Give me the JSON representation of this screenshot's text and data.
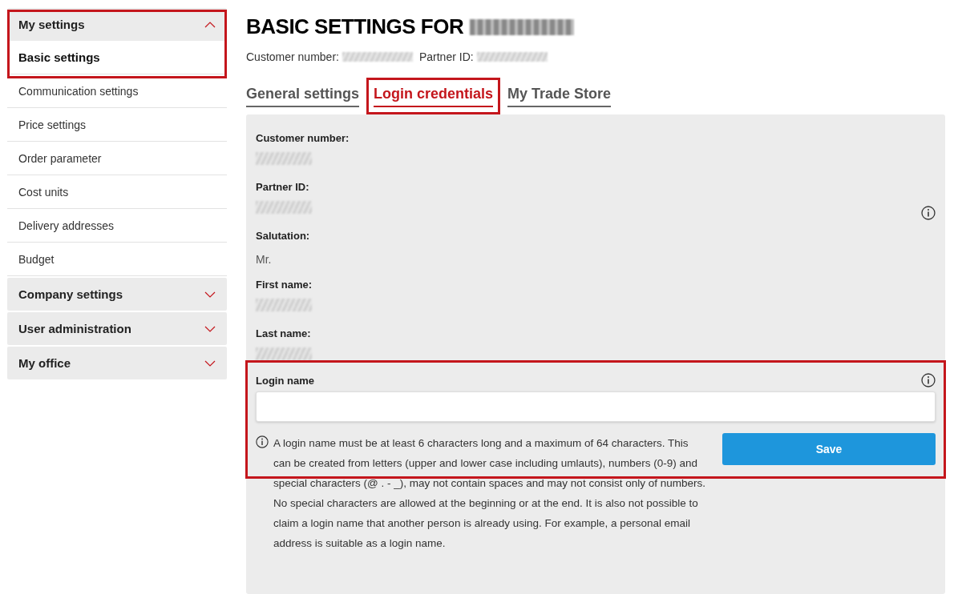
{
  "sidebar": {
    "groups": [
      {
        "title": "My settings",
        "expanded": true,
        "highlighted": true,
        "items": [
          {
            "label": "Basic settings",
            "selected": true
          },
          {
            "label": "Communication settings",
            "selected": false
          },
          {
            "label": "Price settings",
            "selected": false
          },
          {
            "label": "Order parameter",
            "selected": false
          },
          {
            "label": "Cost units",
            "selected": false
          },
          {
            "label": "Delivery addresses",
            "selected": false
          },
          {
            "label": "Budget",
            "selected": false
          }
        ]
      },
      {
        "title": "Company settings",
        "expanded": false,
        "highlighted": false
      },
      {
        "title": "User administration",
        "expanded": false,
        "highlighted": false
      },
      {
        "title": "My office",
        "expanded": false,
        "highlighted": false
      }
    ]
  },
  "header": {
    "title": "BASIC SETTINGS FOR",
    "name_redacted": true,
    "meta": [
      {
        "label": "Customer number:",
        "redacted": true
      },
      {
        "label": "Partner ID:",
        "redacted": true
      }
    ]
  },
  "tabs": [
    {
      "label": "General settings",
      "selected": false,
      "highlighted": false
    },
    {
      "label": "Login credentials",
      "selected": true,
      "highlighted": true
    },
    {
      "label": "My Trade Store",
      "selected": false,
      "highlighted": false
    }
  ],
  "fields": [
    {
      "label": "Customer number:",
      "redacted": true
    },
    {
      "label": "Partner ID:",
      "redacted": true
    },
    {
      "label": "Salutation:",
      "value": "Mr."
    },
    {
      "label": "First name:",
      "redacted": true
    },
    {
      "label": "Last name:",
      "redacted": true
    }
  ],
  "login": {
    "label": "Login name",
    "highlighted": true,
    "help": "A login name must be at least 6 characters long and a maximum of 64 characters. This can be created from letters (upper and lower case including umlauts), numbers (0-9) and special characters (@ . - _), may not contain spaces and may not consist only of numbers. No special characters are allowed at the beginning or at the end. It is also not possible to claim a login name that another person is already using. For example, a personal email address is suitable as a login name.",
    "button": "Save"
  }
}
